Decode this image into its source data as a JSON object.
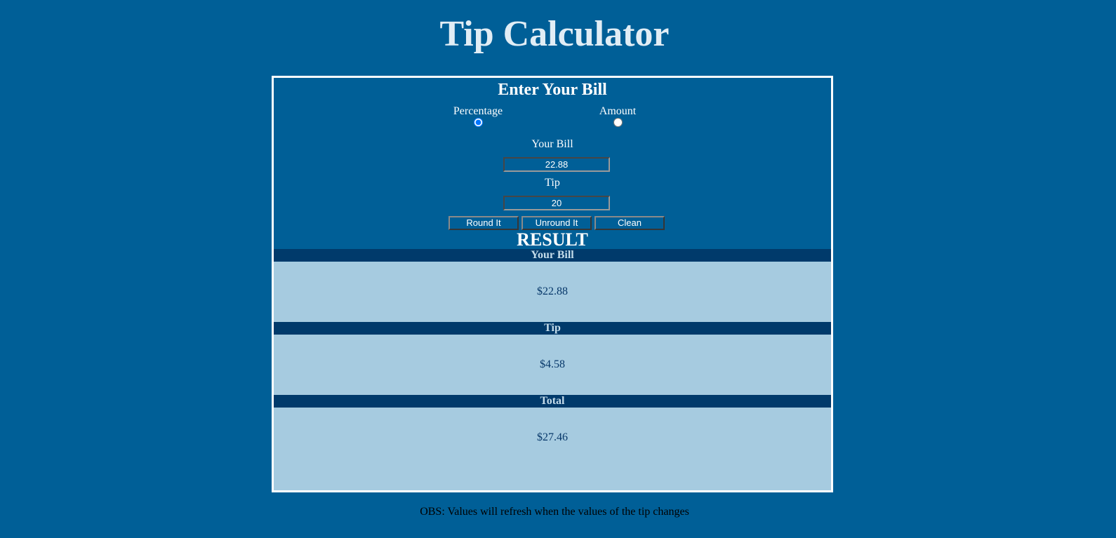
{
  "page": {
    "title": "Tip Calculator",
    "footnote": "OBS: Values will refresh when the values of the tip changes"
  },
  "form": {
    "heading": "Enter Your Bill",
    "mode_options": [
      {
        "label": "Percentage",
        "selected": true
      },
      {
        "label": "Amount",
        "selected": false
      }
    ],
    "bill_label": "Your Bill",
    "bill_value": "22.88",
    "tip_label": "Tip",
    "tip_value": "20",
    "buttons": {
      "round": "Round It",
      "unround": "Unround It",
      "clean": "Clean"
    }
  },
  "result": {
    "heading": "RESULT",
    "rows": [
      {
        "label": "Your Bill",
        "value": "$22.88"
      },
      {
        "label": "Tip",
        "value": "$4.58"
      },
      {
        "label": "Total",
        "value": "$27.46"
      }
    ]
  },
  "colors": {
    "background": "#005f97",
    "result_header": "#003a6b",
    "result_body": "#a6cbe0",
    "title_text": "#e1edf5"
  }
}
